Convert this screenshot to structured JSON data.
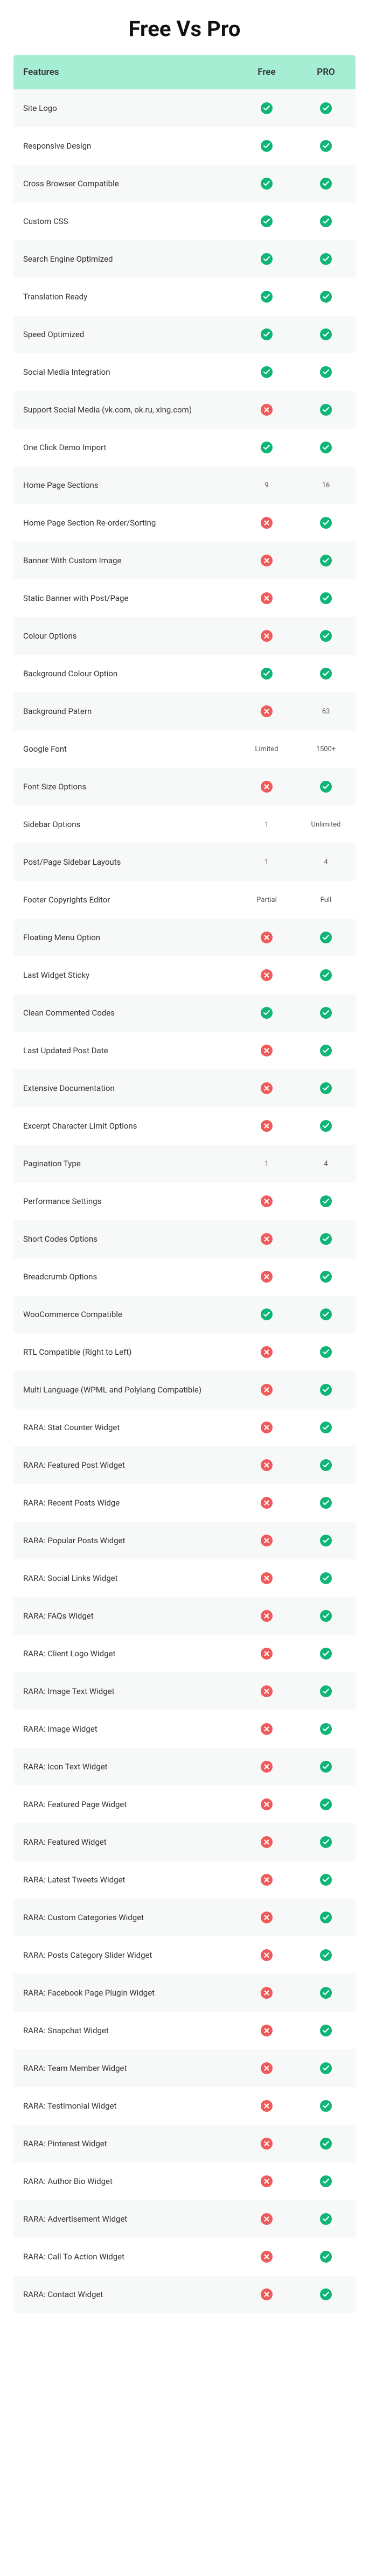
{
  "title": "Free Vs Pro",
  "columns": {
    "feature": "Features",
    "free": "Free",
    "pro": "PRO"
  },
  "rows": [
    {
      "feature": "Site Logo",
      "free": "check",
      "pro": "check"
    },
    {
      "feature": "Responsive Design",
      "free": "check",
      "pro": "check"
    },
    {
      "feature": "Cross Browser Compatible",
      "free": "check",
      "pro": "check"
    },
    {
      "feature": "Custom CSS",
      "free": "check",
      "pro": "check"
    },
    {
      "feature": "Search Engine Optimized",
      "free": "check",
      "pro": "check"
    },
    {
      "feature": "Translation Ready",
      "free": "check",
      "pro": "check"
    },
    {
      "feature": "Speed Optimized",
      "free": "check",
      "pro": "check"
    },
    {
      "feature": "Social Media Integration",
      "free": "check",
      "pro": "check"
    },
    {
      "feature": "Support Social Media (vk.com, ok.ru, xing.com)",
      "free": "cross",
      "pro": "check"
    },
    {
      "feature": "One Click Demo Import",
      "free": "check",
      "pro": "check"
    },
    {
      "feature": "Home Page Sections",
      "free": "9",
      "pro": "16"
    },
    {
      "feature": "Home Page Section Re-order/Sorting",
      "free": "cross",
      "pro": "check"
    },
    {
      "feature": "Banner With Custom Image",
      "free": "cross",
      "pro": "check"
    },
    {
      "feature": "Static Banner with Post/Page",
      "free": "cross",
      "pro": "check"
    },
    {
      "feature": "Colour Options",
      "free": "cross",
      "pro": "check"
    },
    {
      "feature": "Background Colour Option",
      "free": "check",
      "pro": "check"
    },
    {
      "feature": "Background Patern",
      "free": "cross",
      "pro": "63"
    },
    {
      "feature": "Google Font",
      "free": "Limited",
      "pro": "1500+"
    },
    {
      "feature": "Font Size Options",
      "free": "cross",
      "pro": "check"
    },
    {
      "feature": "Sidebar Options",
      "free": "1",
      "pro": "Unlimited"
    },
    {
      "feature": "Post/Page Sidebar Layouts",
      "free": "1",
      "pro": "4"
    },
    {
      "feature": "Footer Copyrights Editor",
      "free": "Partial",
      "pro": "Full"
    },
    {
      "feature": "Floating Menu Option",
      "free": "cross",
      "pro": "check"
    },
    {
      "feature": "Last Widget Sticky",
      "free": "cross",
      "pro": "check"
    },
    {
      "feature": "Clean Commented Codes",
      "free": "check",
      "pro": "check"
    },
    {
      "feature": "Last Updated Post Date",
      "free": "cross",
      "pro": "check"
    },
    {
      "feature": "Extensive Documentation",
      "free": "cross",
      "pro": "check"
    },
    {
      "feature": "Excerpt Character Limit Options",
      "free": "cross",
      "pro": "check"
    },
    {
      "feature": "Pagination Type",
      "free": "1",
      "pro": "4"
    },
    {
      "feature": "Performance Settings",
      "free": "cross",
      "pro": "check"
    },
    {
      "feature": "Short Codes Options",
      "free": "cross",
      "pro": "check"
    },
    {
      "feature": "Breadcrumb Options",
      "free": "cross",
      "pro": "check"
    },
    {
      "feature": "WooCommerce Compatible",
      "free": "check",
      "pro": "check"
    },
    {
      "feature": "RTL Compatible (Right to Left)",
      "free": "cross",
      "pro": "check"
    },
    {
      "feature": "Multi Language (WPML and Polylang Compatible)",
      "free": "cross",
      "pro": "check"
    },
    {
      "feature": "RARA: Stat Counter Widget",
      "free": "cross",
      "pro": "check"
    },
    {
      "feature": "RARA: Featured Post Widget",
      "free": "cross",
      "pro": "check"
    },
    {
      "feature": "RARA: Recent Posts Widge",
      "free": "cross",
      "pro": "check"
    },
    {
      "feature": "RARA: Popular Posts Widget",
      "free": "cross",
      "pro": "check"
    },
    {
      "feature": "RARA: Social Links Widget",
      "free": "cross",
      "pro": "check"
    },
    {
      "feature": "RARA: FAQs Widget",
      "free": "cross",
      "pro": "check"
    },
    {
      "feature": "RARA: Client Logo Widget",
      "free": "cross",
      "pro": "check"
    },
    {
      "feature": "RARA: Image Text Widget",
      "free": "cross",
      "pro": "check"
    },
    {
      "feature": "RARA: Image Widget",
      "free": "cross",
      "pro": "check"
    },
    {
      "feature": "RARA: Icon Text Widget",
      "free": "cross",
      "pro": "check"
    },
    {
      "feature": "RARA: Featured Page Widget",
      "free": "cross",
      "pro": "check"
    },
    {
      "feature": "RARA: Featured Widget",
      "free": "cross",
      "pro": "check"
    },
    {
      "feature": "RARA: Latest Tweets Widget",
      "free": "cross",
      "pro": "check"
    },
    {
      "feature": "RARA: Custom Categories Widget",
      "free": "cross",
      "pro": "check"
    },
    {
      "feature": "RARA: Posts Category Slider Widget",
      "free": "cross",
      "pro": "check"
    },
    {
      "feature": "RARA: Facebook Page Plugin Widget",
      "free": "cross",
      "pro": "check"
    },
    {
      "feature": "RARA: Snapchat Widget",
      "free": "cross",
      "pro": "check"
    },
    {
      "feature": "RARA: Team Member Widget",
      "free": "cross",
      "pro": "check"
    },
    {
      "feature": "RARA: Testimonial Widget",
      "free": "cross",
      "pro": "check"
    },
    {
      "feature": "RARA: Pinterest Widget",
      "free": "cross",
      "pro": "check"
    },
    {
      "feature": "RARA: Author Bio Widget",
      "free": "cross",
      "pro": "check"
    },
    {
      "feature": "RARA: Advertisement Widget",
      "free": "cross",
      "pro": "check"
    },
    {
      "feature": "RARA: Call To Action Widget",
      "free": "cross",
      "pro": "check"
    },
    {
      "feature": "RARA: Contact Widget",
      "free": "cross",
      "pro": "check"
    }
  ]
}
